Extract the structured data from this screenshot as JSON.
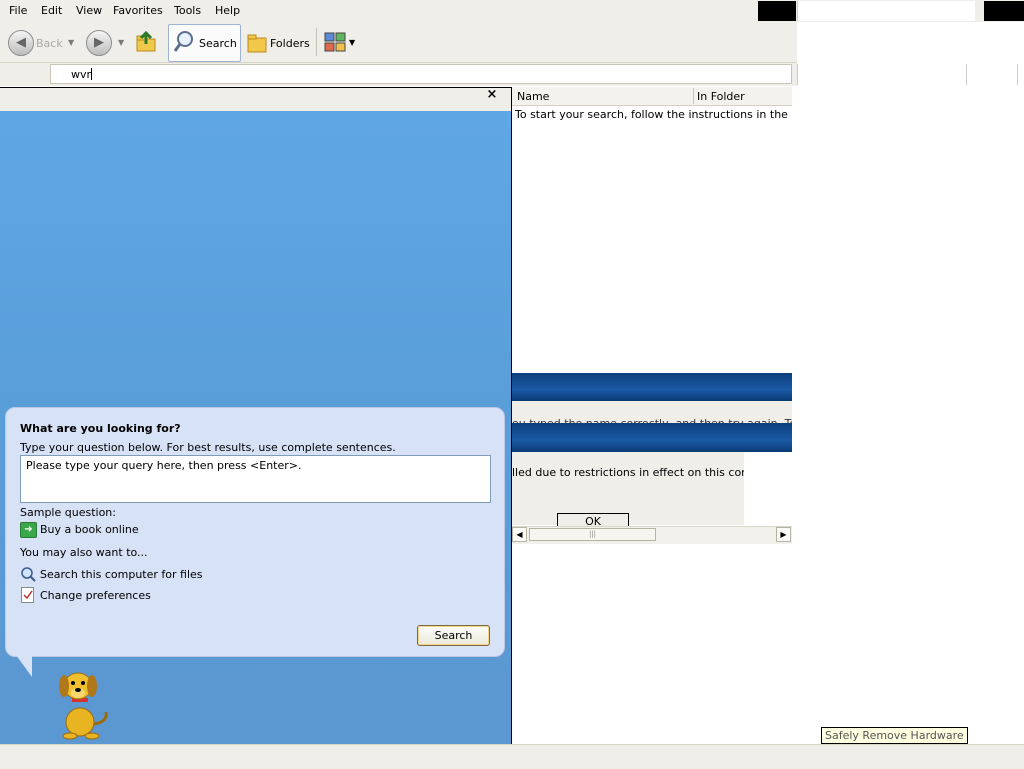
{
  "menu": {
    "items": [
      "File",
      "Edit",
      "View",
      "Favorites",
      "Tools",
      "Help"
    ]
  },
  "toolbar": {
    "back_label": "Back",
    "search_label": "Search",
    "folders_label": "Folders"
  },
  "address": {
    "value": "wvr"
  },
  "search_pane": {
    "bubble_title": "What are you looking for?",
    "bubble_subtitle": "Type your question below. For best results, use complete sentences.",
    "query_placeholder": "Please type your query here, then press <Enter>.",
    "sample_label": "Sample question:",
    "sample_link": "Buy a book online",
    "also_label": "You may also want to...",
    "also_links": [
      "Search this computer for files",
      "Change preferences"
    ],
    "submit_label": "Search",
    "close_glyph": "×"
  },
  "results": {
    "columns": [
      "Name",
      "In Folder"
    ],
    "message": "To start your search, follow the instructions in the left par"
  },
  "dialog": {
    "partial_text": "ou typed the name correctly, and then try again. To se",
    "message": "lled due to restrictions in effect on this computer.",
    "ok_label": "OK"
  },
  "tooltip": {
    "text": "Safely Remove Hardware"
  }
}
